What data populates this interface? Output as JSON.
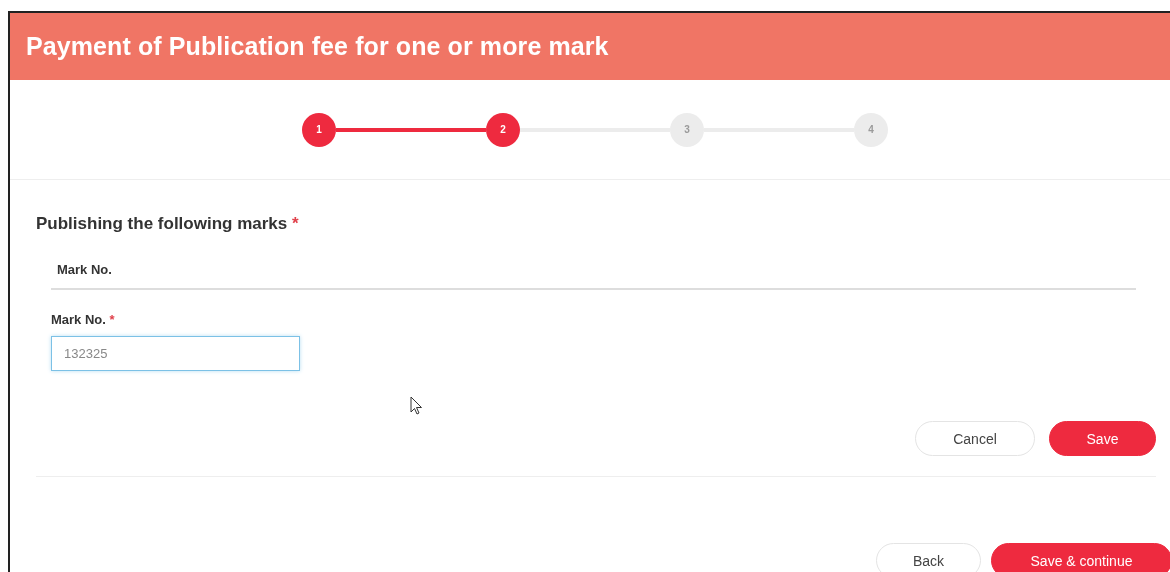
{
  "header": {
    "title": "Payment of Publication fee for one or more mark"
  },
  "stepper": {
    "steps": [
      {
        "label": "1",
        "done": true
      },
      {
        "label": "2",
        "done": true
      },
      {
        "label": "3",
        "done": false
      },
      {
        "label": "4",
        "done": false
      }
    ]
  },
  "section": {
    "title": "Publishing the following marks",
    "required_mark": "*"
  },
  "table": {
    "columns": [
      "Mark No."
    ]
  },
  "field": {
    "label": "Mark No.",
    "required_mark": "*",
    "value": "132325",
    "focused": true
  },
  "form_buttons": [
    {
      "label": "Cancel",
      "kind": "secondary"
    },
    {
      "label": "Save",
      "kind": "primary"
    }
  ],
  "footer_buttons": [
    {
      "label": "Back",
      "kind": "secondary"
    },
    {
      "label": "Save & continue",
      "kind": "primary"
    }
  ]
}
